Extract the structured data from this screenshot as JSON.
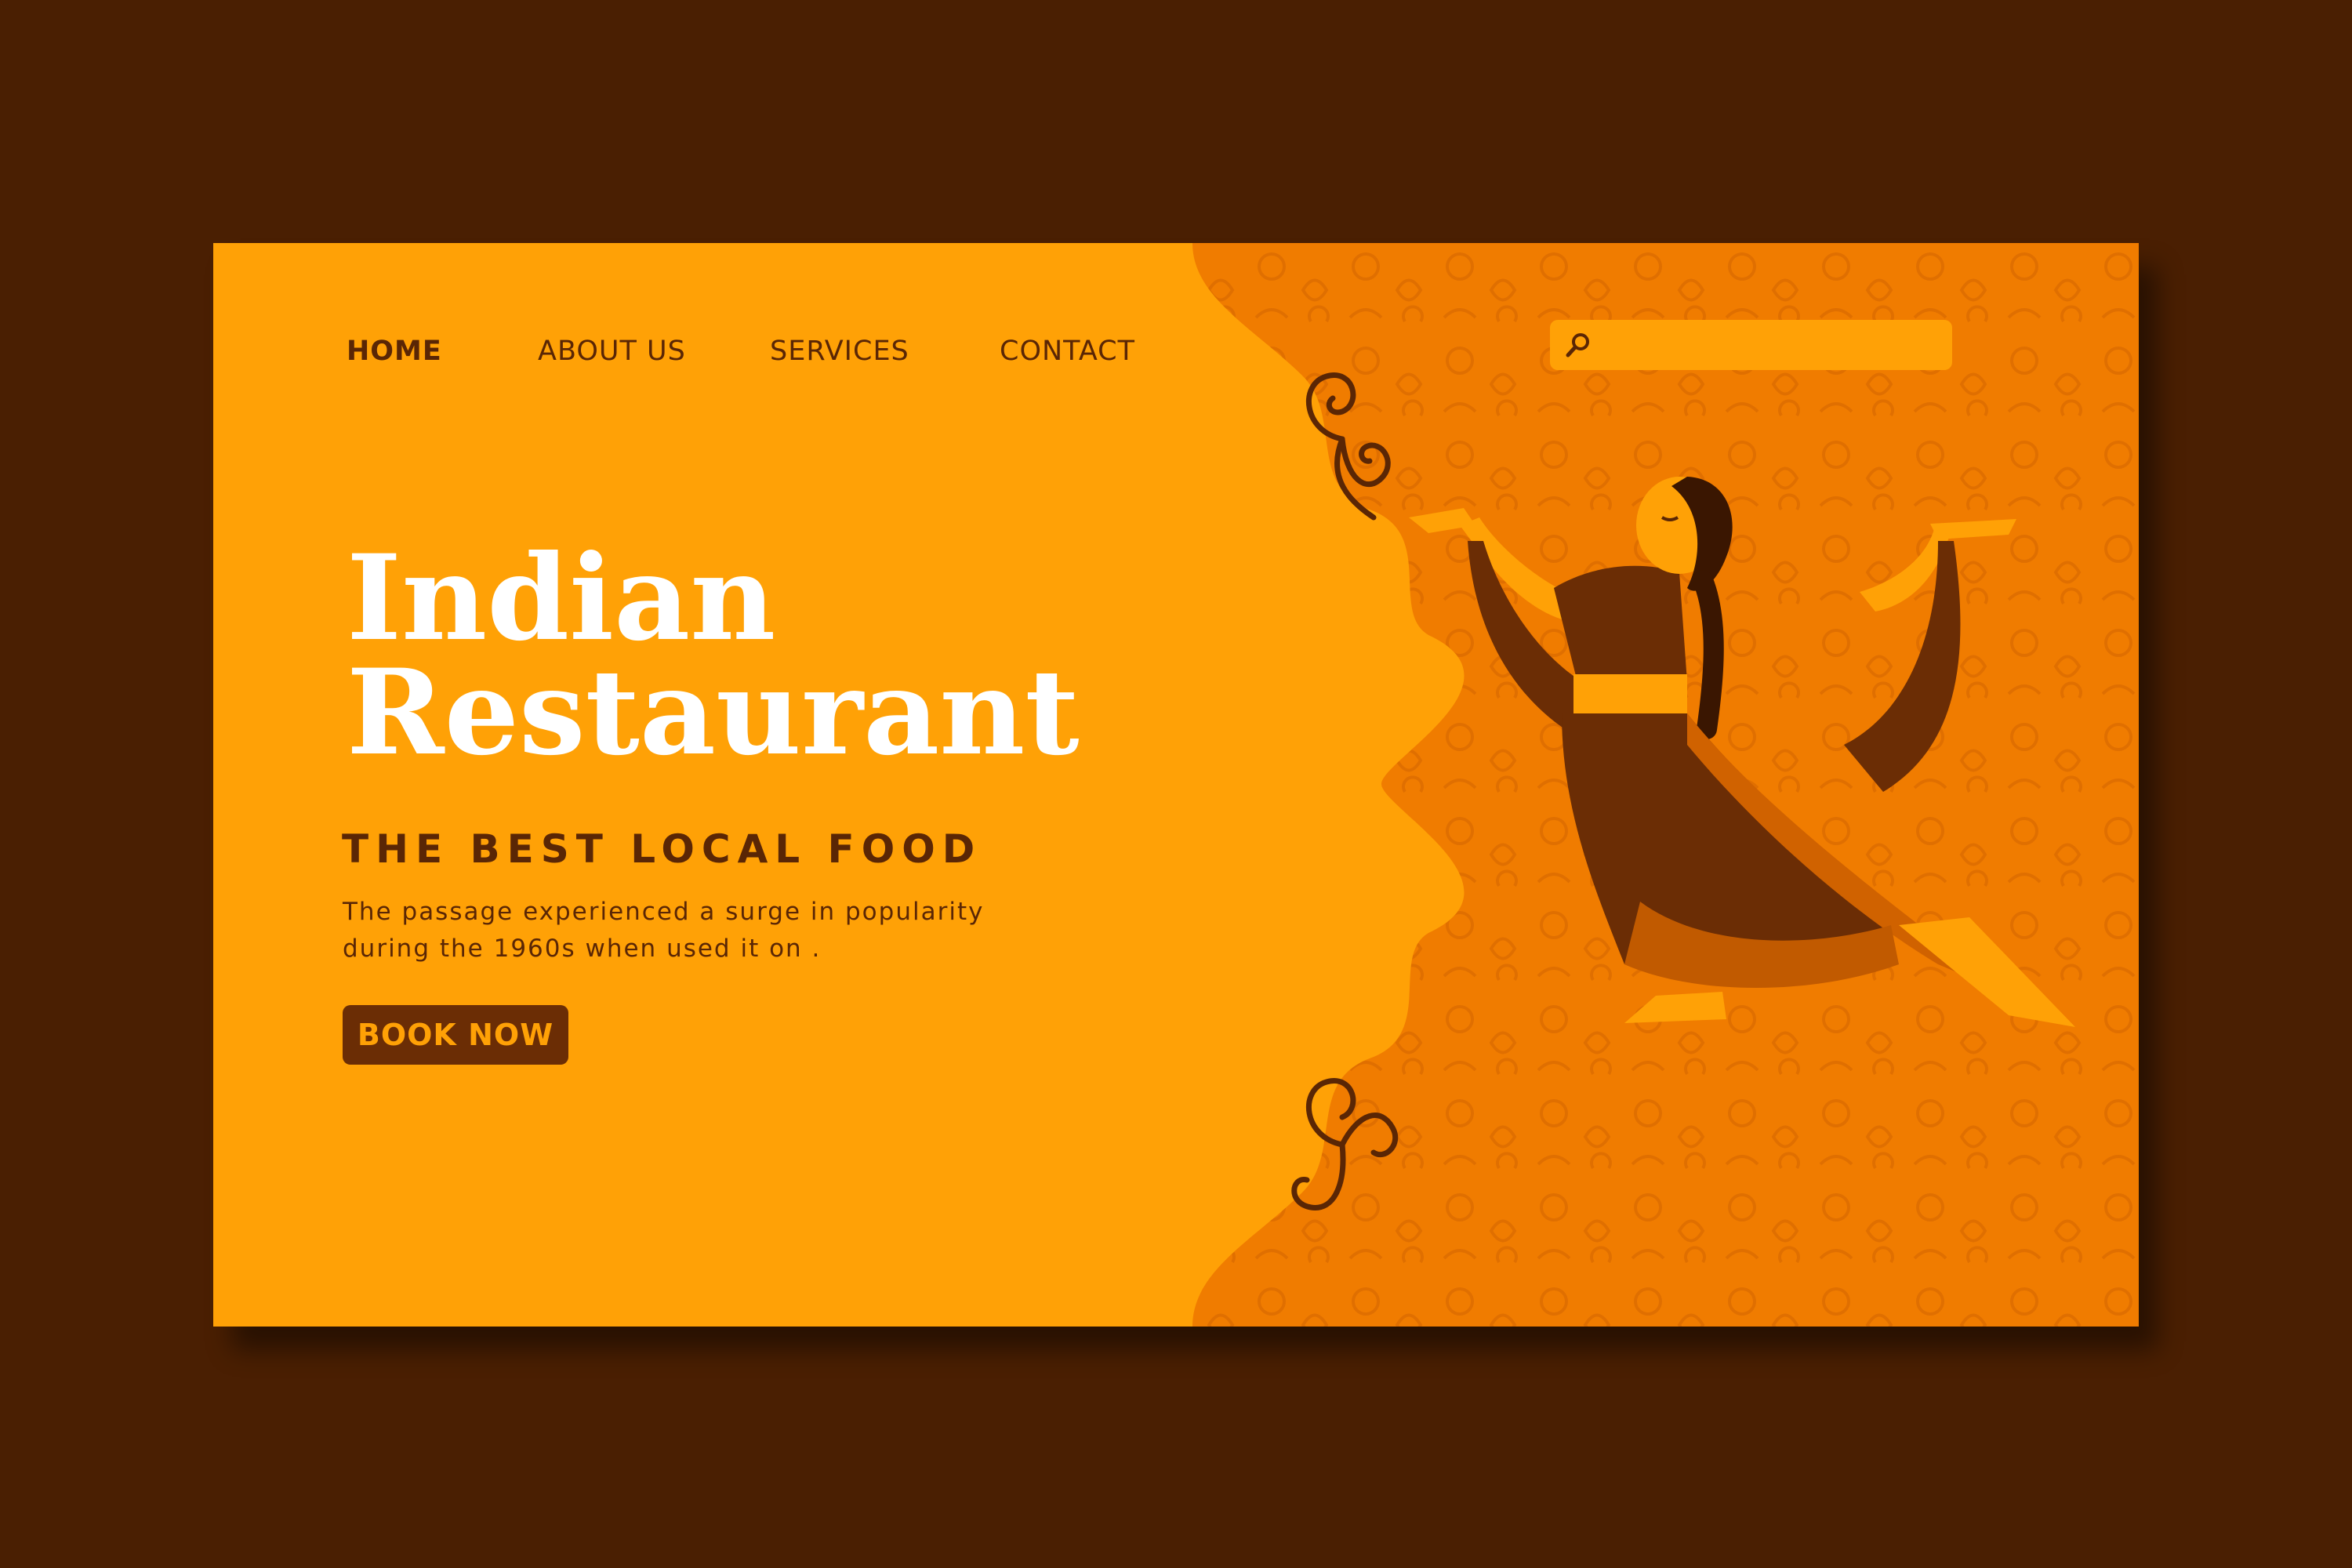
{
  "nav": {
    "items": [
      {
        "label": "HOME",
        "active": true
      },
      {
        "label": "ABOUT US",
        "active": false
      },
      {
        "label": "SERVICES",
        "active": false
      },
      {
        "label": "CONTACT",
        "active": false
      }
    ]
  },
  "search": {
    "placeholder": "",
    "value": "",
    "icon": "search-icon"
  },
  "hero": {
    "title_line1": "Indian",
    "title_line2": "Restaurant",
    "tagline": "THE BEST LOCAL FOOD",
    "description_line1": "The passage experienced a surge in popularity",
    "description_line2": "during the 1960s when used it on .",
    "cta_label": "BOOK NOW"
  },
  "illustration": {
    "icon": "dancer-illustration"
  },
  "colors": {
    "background": "#4a1f02",
    "panel_left": "#ffa106",
    "panel_right": "#f07c00",
    "text_dark": "#5a2605",
    "button_bg": "#6b2d05",
    "white": "#ffffff"
  }
}
